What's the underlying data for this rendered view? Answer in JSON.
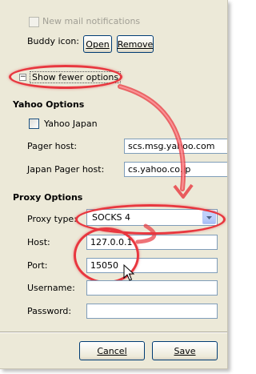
{
  "mail": {
    "new_mail_label": "New mail notifications"
  },
  "buddy": {
    "label": "Buddy icon:",
    "open_label": "Open",
    "remove_label": "Remove"
  },
  "toggle": {
    "label": "Show fewer options",
    "symbol": "−"
  },
  "yahoo": {
    "heading": "Yahoo Options",
    "japan_label": "Yahoo Japan",
    "pager_host_label": "Pager host:",
    "pager_host_value": "scs.msg.yahoo.com",
    "japan_pager_host_label": "Japan Pager host:",
    "japan_pager_host_value": "cs.yahoo.co.jp"
  },
  "proxy": {
    "heading": "Proxy Options",
    "type_label": "Proxy type:",
    "type_value": "SOCKS 4",
    "host_label": "Host:",
    "host_value": "127.0.0.1",
    "port_label": "Port:",
    "port_value": "15050",
    "username_label": "Username:",
    "username_value": "",
    "password_label": "Password:",
    "password_value": ""
  },
  "footer": {
    "cancel_label": "Cancel",
    "save_label": "Save"
  },
  "colors": {
    "annotation": "#e8373f",
    "dialog_bg": "#ece9d8",
    "field_border": "#7f9db9"
  },
  "icons": [
    "expand-collapse-icon",
    "dropdown-arrow-icon",
    "mouse-cursor-icon"
  ]
}
